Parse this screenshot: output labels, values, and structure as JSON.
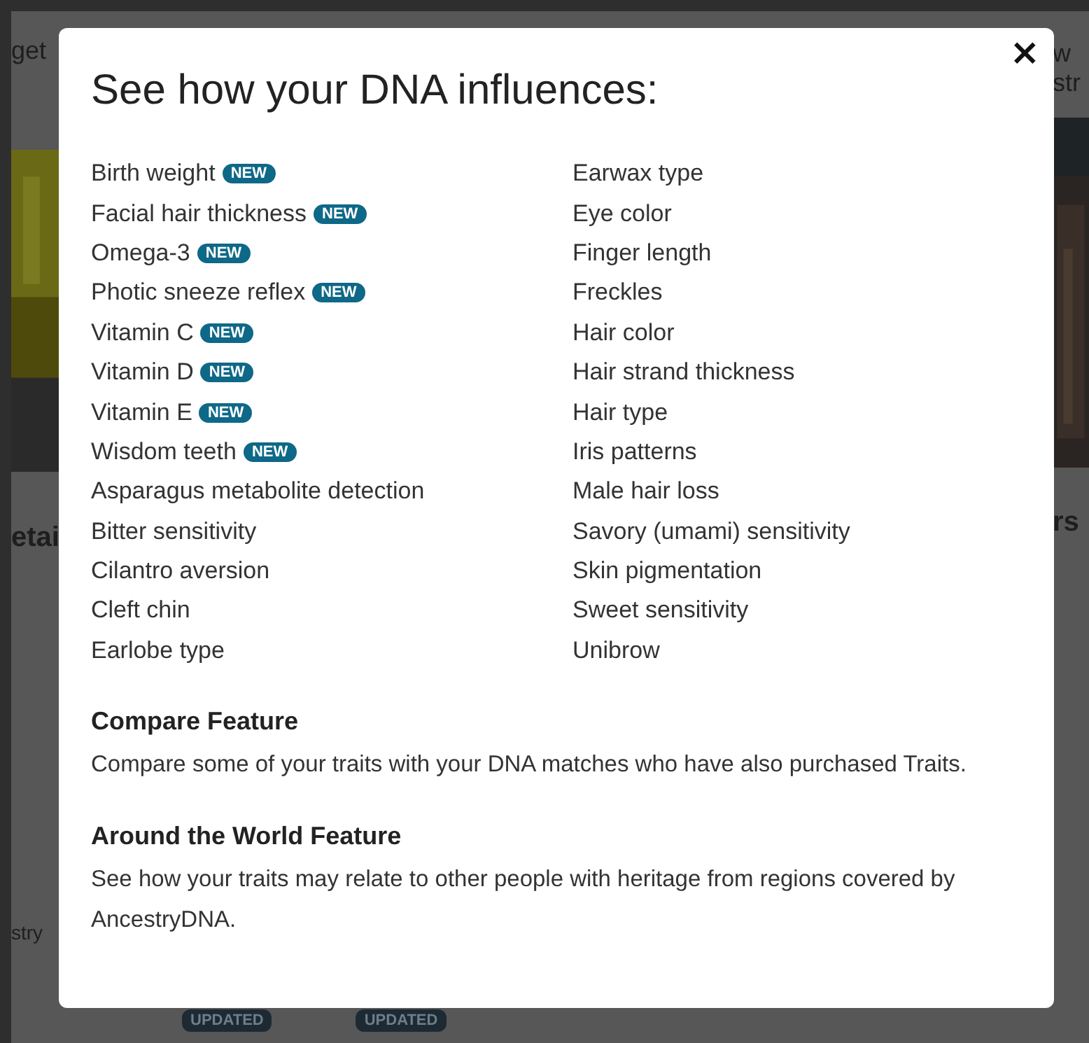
{
  "background": {
    "left_texts": [
      "get",
      "etai",
      "stry"
    ],
    "right_texts": [
      "w",
      "str",
      "rs"
    ],
    "footer_badges": [
      "UPDATED",
      "UPDATED"
    ]
  },
  "dialog": {
    "close": "×",
    "title": "See how your DNA influences:",
    "columns": [
      [
        {
          "label": "Birth weight",
          "badge": "NEW"
        },
        {
          "label": "Facial hair thickness",
          "badge": "NEW"
        },
        {
          "label": "Omega-3",
          "badge": "NEW"
        },
        {
          "label": "Photic sneeze reflex",
          "badge": "NEW"
        },
        {
          "label": "Vitamin C",
          "badge": "NEW"
        },
        {
          "label": "Vitamin D",
          "badge": "NEW"
        },
        {
          "label": "Vitamin E",
          "badge": "NEW"
        },
        {
          "label": "Wisdom teeth",
          "badge": "NEW"
        },
        {
          "label": "Asparagus metabolite detection"
        },
        {
          "label": "Bitter sensitivity"
        },
        {
          "label": "Cilantro aversion"
        },
        {
          "label": "Cleft chin"
        },
        {
          "label": "Earlobe type"
        }
      ],
      [
        {
          "label": "Earwax type"
        },
        {
          "label": "Eye color"
        },
        {
          "label": "Finger length"
        },
        {
          "label": "Freckles"
        },
        {
          "label": "Hair color"
        },
        {
          "label": "Hair strand thickness"
        },
        {
          "label": "Hair type"
        },
        {
          "label": "Iris patterns"
        },
        {
          "label": "Male hair loss"
        },
        {
          "label": "Savory (umami) sensitivity"
        },
        {
          "label": "Skin pigmentation"
        },
        {
          "label": "Sweet sensitivity"
        },
        {
          "label": "Unibrow"
        }
      ]
    ],
    "sections": [
      {
        "heading": "Compare Feature",
        "text": "Compare some of your traits with your DNA matches who have also purchased Traits."
      },
      {
        "heading": "Around the World Feature",
        "text": "See how your traits may relate to other people with heritage from regions covered by AncestryDNA."
      }
    ]
  }
}
